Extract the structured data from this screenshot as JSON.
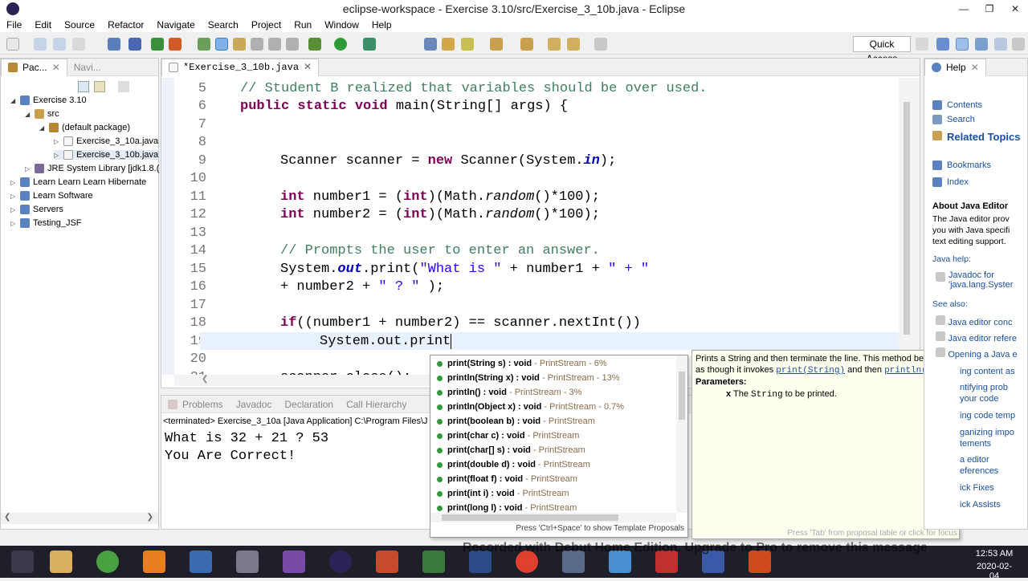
{
  "window": {
    "title": "eclipse-workspace - Exercise 3.10/src/Exercise_3_10b.java - Eclipse",
    "minimize": "—",
    "restore": "❐",
    "close": "✕"
  },
  "menu": [
    "File",
    "Edit",
    "Source",
    "Refactor",
    "Navigate",
    "Search",
    "Project",
    "Run",
    "Window",
    "Help"
  ],
  "quick_access": "Quick Access",
  "package_explorer": {
    "tabs": [
      "Pac...",
      "Navi..."
    ],
    "items": [
      {
        "label": "Exercise 3.10"
      },
      {
        "label": "src"
      },
      {
        "label": "(default package)"
      },
      {
        "label": "Exercise_3_10a.java"
      },
      {
        "label": "Exercise_3_10b.java"
      },
      {
        "label": "JRE System Library [jdk1.8.("
      },
      {
        "label": "Learn Learn Learn Hibernate"
      },
      {
        "label": "Learn Software"
      },
      {
        "label": "Servers"
      },
      {
        "label": "Testing_JSF"
      }
    ]
  },
  "editor": {
    "tab": "*Exercise_3_10b.java",
    "line_numbers": [
      "5",
      "6",
      "7",
      "8",
      "9",
      "10",
      "11",
      "12",
      "13",
      "14",
      "15",
      "16",
      "17",
      "18",
      "19",
      "20",
      "21"
    ]
  },
  "bottom": {
    "tabs": [
      "Problems",
      "Javadoc",
      "Declaration",
      "Call Hierarchy"
    ],
    "terminated": "<terminated> Exercise_3_10a [Java Application] C:\\Program Files\\J",
    "console_lines": [
      "What is 32 + 21 ? 53",
      "You Are Correct!"
    ]
  },
  "autocomplete": {
    "items": [
      {
        "name": "print(String s) : void",
        "type": " - PrintStream - 6%"
      },
      {
        "name": "println(String x) : void",
        "type": " - PrintStream - 13%"
      },
      {
        "name": "println() : void",
        "type": " - PrintStream - 3%"
      },
      {
        "name": "println(Object x) : void",
        "type": " - PrintStream - 0.7%"
      },
      {
        "name": "print(boolean b) : void",
        "type": " - PrintStream"
      },
      {
        "name": "print(char c) : void",
        "type": " - PrintStream"
      },
      {
        "name": "print(char[] s) : void",
        "type": " - PrintStream"
      },
      {
        "name": "print(double d) : void",
        "type": " - PrintStream"
      },
      {
        "name": "print(float f) : void",
        "type": " - PrintStream"
      },
      {
        "name": "print(int i) : void",
        "type": " - PrintStream"
      },
      {
        "name": "print(long l) : void",
        "type": " - PrintStream"
      }
    ],
    "footer": "Press 'Ctrl+Space' to show Template Proposals"
  },
  "javadoc_popup": {
    "text1": "Prints a String and then terminate the line. This method behaves",
    "text2_a": "as though it invokes ",
    "text2_link1": "print(String)",
    "text2_b": " and then ",
    "text2_link2": "println()",
    "text2_c": ".",
    "params_label": "Parameters:",
    "param_x": "x",
    "param_a": " The ",
    "param_code": "String",
    "param_b": " to be printed.",
    "footer": "Press 'Tab' from proposal table or click for focus"
  },
  "help": {
    "tab": "Help",
    "links": [
      "Contents",
      "Search",
      "Related Topics",
      "Bookmarks",
      "Index"
    ],
    "about_title": "About Java Editor",
    "about_text": [
      "The Java editor prov",
      "you with Java specifi",
      "text editing support."
    ],
    "java_help": "Java help:",
    "javadoc_link": [
      "Javadoc for",
      "'java.lang.Syster"
    ],
    "see_also": "See also:",
    "see_links": [
      "Java editor conc",
      "Java editor refere",
      "Opening a Java e",
      "ing content as",
      "ntifying prob",
      "your code",
      "ing code temp",
      "ganizing impo",
      "tements",
      "a editor",
      "eferences",
      "ick Fixes",
      "ick Assists"
    ]
  },
  "taskbar": {
    "time": "12:53 AM",
    "date": "2020-02-04",
    "watermark": "Recorded with Debut Home Edition. Upgrade to Pro to remove this message"
  }
}
